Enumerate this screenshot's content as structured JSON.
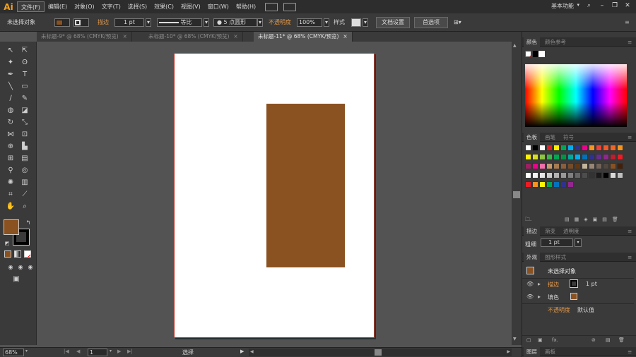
{
  "menubar": {
    "logo": "Ai",
    "menus": [
      "文件(F)",
      "编辑(E)",
      "对象(O)",
      "文字(T)",
      "选择(S)",
      "效果(C)",
      "视图(V)",
      "窗口(W)",
      "帮助(H)"
    ],
    "workspace": "基本功能",
    "win": [
      "–",
      "❐",
      "✕"
    ]
  },
  "control": {
    "selection_label": "未选择对象",
    "stroke_label": "描边",
    "stroke_weight": "1 pt",
    "stroke_profile": "等比",
    "brush": "5 点圆形",
    "opacity_label": "不透明度",
    "opacity_value": "100%",
    "style_label": "样式",
    "doc_setup": "文档设置",
    "preferences": "首选项",
    "fill_color": "#8a5221"
  },
  "tabs": [
    {
      "label": "未标题-9* @ 68% (CMYK/预览)",
      "close": "×"
    },
    {
      "label": "未标题-10* @ 68% (CMYK/预览)",
      "close": "×"
    },
    {
      "label": "未标题-11* @ 68% (CMYK/预览)",
      "close": "×"
    }
  ],
  "canvas": {
    "rect_color": "#8a5221"
  },
  "status": {
    "zoom": "68%",
    "page": "1",
    "tool": "选择"
  },
  "panels": {
    "color_tabs": [
      "颜色",
      "颜色参考"
    ],
    "swatch_tabs": [
      "色板",
      "画笔",
      "符号"
    ],
    "stroke_tabs": [
      "描边",
      "渐变",
      "透明度"
    ],
    "stroke_weight_label": "粗细",
    "stroke_weight_value": "1 pt",
    "appearance_tabs": [
      "外观",
      "图形样式"
    ],
    "appearance_title": "未选择对象",
    "appearance_stroke": "描边",
    "appearance_stroke_value": "1 pt",
    "appearance_fill": "填色",
    "appearance_opacity": "不透明度",
    "appearance_opacity_value": "默认值",
    "bottom_tabs": [
      "图层",
      "画板"
    ],
    "fx": "fx."
  },
  "colors": {
    "fill": "#8a5221",
    "swatches_row1": [
      "#ffffff",
      "#000000",
      "#ffffff",
      "#e31e24",
      "#ffed00",
      "#00a651",
      "#00aeef",
      "#2e3192",
      "#ec008c",
      "#f7941d",
      "#ef4136",
      "#f15a29",
      "#f26522",
      "#f7941d"
    ],
    "swatches_row2": [
      "#fff200",
      "#d7df23",
      "#8dc63f",
      "#39b54a",
      "#00a651",
      "#009444",
      "#00a99d",
      "#00aeef",
      "#0072bc",
      "#2e3192",
      "#662d91",
      "#92278f",
      "#be1e2d",
      "#ed1c24"
    ],
    "swatches_row3": [
      "#9e1f63",
      "#ec008c",
      "#f06eaa",
      "#c49a6c",
      "#a67c52",
      "#8b5e3c",
      "#754c29",
      "#603913",
      "#c2b59b",
      "#998675",
      "#736357",
      "#534741",
      "#8a5221",
      "#42210b"
    ],
    "swatches_row4": [
      "#ffffff",
      "#f2f2f2",
      "#e6e6e6",
      "#cccccc",
      "#b3b3b3",
      "#999999",
      "#808080",
      "#666666",
      "#4d4d4d",
      "#333333",
      "#1a1a1a",
      "#000000",
      "#d9d9d9",
      "#bfbfbf"
    ],
    "swatches_row5": [
      "#ed1c24",
      "#f7941d",
      "#fff200",
      "#00a651",
      "#0072bc",
      "#2e3192",
      "#92278f"
    ]
  }
}
